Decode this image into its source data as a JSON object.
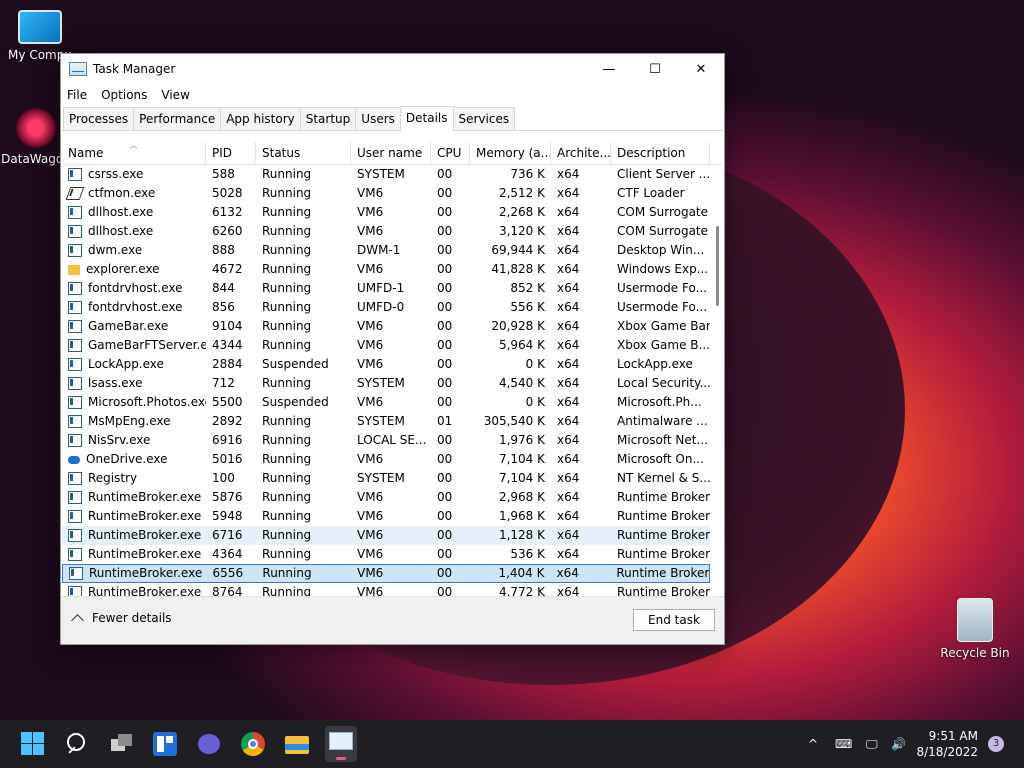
{
  "desktop": {
    "icons": [
      {
        "label": "My Compu"
      },
      {
        "label": "DataWagon"
      },
      {
        "label": "Recycle Bin"
      }
    ]
  },
  "window": {
    "title": "Task Manager",
    "controls": {
      "minimize": "—",
      "maximize": "☐",
      "close": "✕"
    },
    "menu": [
      "File",
      "Options",
      "View"
    ],
    "tabs": [
      "Processes",
      "Performance",
      "App history",
      "Startup",
      "Users",
      "Details",
      "Services"
    ],
    "active_tab": "Details",
    "columns": [
      "Name",
      "PID",
      "Status",
      "User name",
      "CPU",
      "Memory (a...",
      "Archite...",
      "Description"
    ],
    "rows": [
      {
        "icon": "exe",
        "name": "csrss.exe",
        "pid": "588",
        "status": "Running",
        "user": "SYSTEM",
        "cpu": "00",
        "mem": "736 K",
        "arch": "x64",
        "desc": "Client Server ..."
      },
      {
        "icon": "pen",
        "name": "ctfmon.exe",
        "pid": "5028",
        "status": "Running",
        "user": "VM6",
        "cpu": "00",
        "mem": "2,512 K",
        "arch": "x64",
        "desc": "CTF Loader"
      },
      {
        "icon": "exe",
        "name": "dllhost.exe",
        "pid": "6132",
        "status": "Running",
        "user": "VM6",
        "cpu": "00",
        "mem": "2,268 K",
        "arch": "x64",
        "desc": "COM Surrogate"
      },
      {
        "icon": "exe",
        "name": "dllhost.exe",
        "pid": "6260",
        "status": "Running",
        "user": "VM6",
        "cpu": "00",
        "mem": "3,120 K",
        "arch": "x64",
        "desc": "COM Surrogate"
      },
      {
        "icon": "exe",
        "name": "dwm.exe",
        "pid": "888",
        "status": "Running",
        "user": "DWM-1",
        "cpu": "00",
        "mem": "69,944 K",
        "arch": "x64",
        "desc": "Desktop Win..."
      },
      {
        "icon": "folder",
        "name": "explorer.exe",
        "pid": "4672",
        "status": "Running",
        "user": "VM6",
        "cpu": "00",
        "mem": "41,828 K",
        "arch": "x64",
        "desc": "Windows Exp..."
      },
      {
        "icon": "exe",
        "name": "fontdrvhost.exe",
        "pid": "844",
        "status": "Running",
        "user": "UMFD-1",
        "cpu": "00",
        "mem": "852 K",
        "arch": "x64",
        "desc": "Usermode Fo..."
      },
      {
        "icon": "exe",
        "name": "fontdrvhost.exe",
        "pid": "856",
        "status": "Running",
        "user": "UMFD-0",
        "cpu": "00",
        "mem": "556 K",
        "arch": "x64",
        "desc": "Usermode Fo..."
      },
      {
        "icon": "exe",
        "name": "GameBar.exe",
        "pid": "9104",
        "status": "Running",
        "user": "VM6",
        "cpu": "00",
        "mem": "20,928 K",
        "arch": "x64",
        "desc": "Xbox Game Bar"
      },
      {
        "icon": "exe",
        "name": "GameBarFTServer.exe",
        "pid": "4344",
        "status": "Running",
        "user": "VM6",
        "cpu": "00",
        "mem": "5,964 K",
        "arch": "x64",
        "desc": "Xbox Game B..."
      },
      {
        "icon": "exe",
        "name": "LockApp.exe",
        "pid": "2884",
        "status": "Suspended",
        "user": "VM6",
        "cpu": "00",
        "mem": "0 K",
        "arch": "x64",
        "desc": "LockApp.exe"
      },
      {
        "icon": "exe",
        "name": "lsass.exe",
        "pid": "712",
        "status": "Running",
        "user": "SYSTEM",
        "cpu": "00",
        "mem": "4,540 K",
        "arch": "x64",
        "desc": "Local Security..."
      },
      {
        "icon": "exe",
        "name": "Microsoft.Photos.exe",
        "pid": "5500",
        "status": "Suspended",
        "user": "VM6",
        "cpu": "00",
        "mem": "0 K",
        "arch": "x64",
        "desc": "Microsoft.Ph..."
      },
      {
        "icon": "exe",
        "name": "MsMpEng.exe",
        "pid": "2892",
        "status": "Running",
        "user": "SYSTEM",
        "cpu": "01",
        "mem": "305,540 K",
        "arch": "x64",
        "desc": "Antimalware ..."
      },
      {
        "icon": "exe",
        "name": "NisSrv.exe",
        "pid": "6916",
        "status": "Running",
        "user": "LOCAL SE...",
        "cpu": "00",
        "mem": "1,976 K",
        "arch": "x64",
        "desc": "Microsoft Net..."
      },
      {
        "icon": "cloud",
        "name": "OneDrive.exe",
        "pid": "5016",
        "status": "Running",
        "user": "VM6",
        "cpu": "00",
        "mem": "7,104 K",
        "arch": "x64",
        "desc": "Microsoft On..."
      },
      {
        "icon": "exe",
        "name": "Registry",
        "pid": "100",
        "status": "Running",
        "user": "SYSTEM",
        "cpu": "00",
        "mem": "7,104 K",
        "arch": "x64",
        "desc": "NT Kernel & S..."
      },
      {
        "icon": "exe",
        "name": "RuntimeBroker.exe",
        "pid": "5876",
        "status": "Running",
        "user": "VM6",
        "cpu": "00",
        "mem": "2,968 K",
        "arch": "x64",
        "desc": "Runtime Broker"
      },
      {
        "icon": "exe",
        "name": "RuntimeBroker.exe",
        "pid": "5948",
        "status": "Running",
        "user": "VM6",
        "cpu": "00",
        "mem": "1,968 K",
        "arch": "x64",
        "desc": "Runtime Broker"
      },
      {
        "icon": "exe",
        "name": "RuntimeBroker.exe",
        "pid": "6716",
        "status": "Running",
        "user": "VM6",
        "cpu": "00",
        "mem": "1,128 K",
        "arch": "x64",
        "desc": "Runtime Broker",
        "state": "hover"
      },
      {
        "icon": "exe",
        "name": "RuntimeBroker.exe",
        "pid": "4364",
        "status": "Running",
        "user": "VM6",
        "cpu": "00",
        "mem": "536 K",
        "arch": "x64",
        "desc": "Runtime Broker"
      },
      {
        "icon": "exe",
        "name": "RuntimeBroker.exe",
        "pid": "6556",
        "status": "Running",
        "user": "VM6",
        "cpu": "00",
        "mem": "1,404 K",
        "arch": "x64",
        "desc": "Runtime Broker",
        "state": "selected"
      },
      {
        "icon": "exe",
        "name": "RuntimeBroker.exe",
        "pid": "8764",
        "status": "Running",
        "user": "VM6",
        "cpu": "00",
        "mem": "4,772 K",
        "arch": "x64",
        "desc": "Runtime Broker"
      }
    ],
    "footer": {
      "fewer_details": "Fewer details",
      "end_task": "End task"
    }
  },
  "taskbar": {
    "items": [
      "start-icon",
      "search-icon",
      "task-view-icon",
      "widgets-icon",
      "chat-icon",
      "chrome-icon",
      "file-explorer-icon",
      "task-manager-icon"
    ],
    "tray": {
      "chevron": "^",
      "keyboard": "⌨",
      "network": "🖵",
      "volume": "🔊"
    },
    "time": "9:51 AM",
    "date": "8/18/2022",
    "notifications": "3"
  }
}
